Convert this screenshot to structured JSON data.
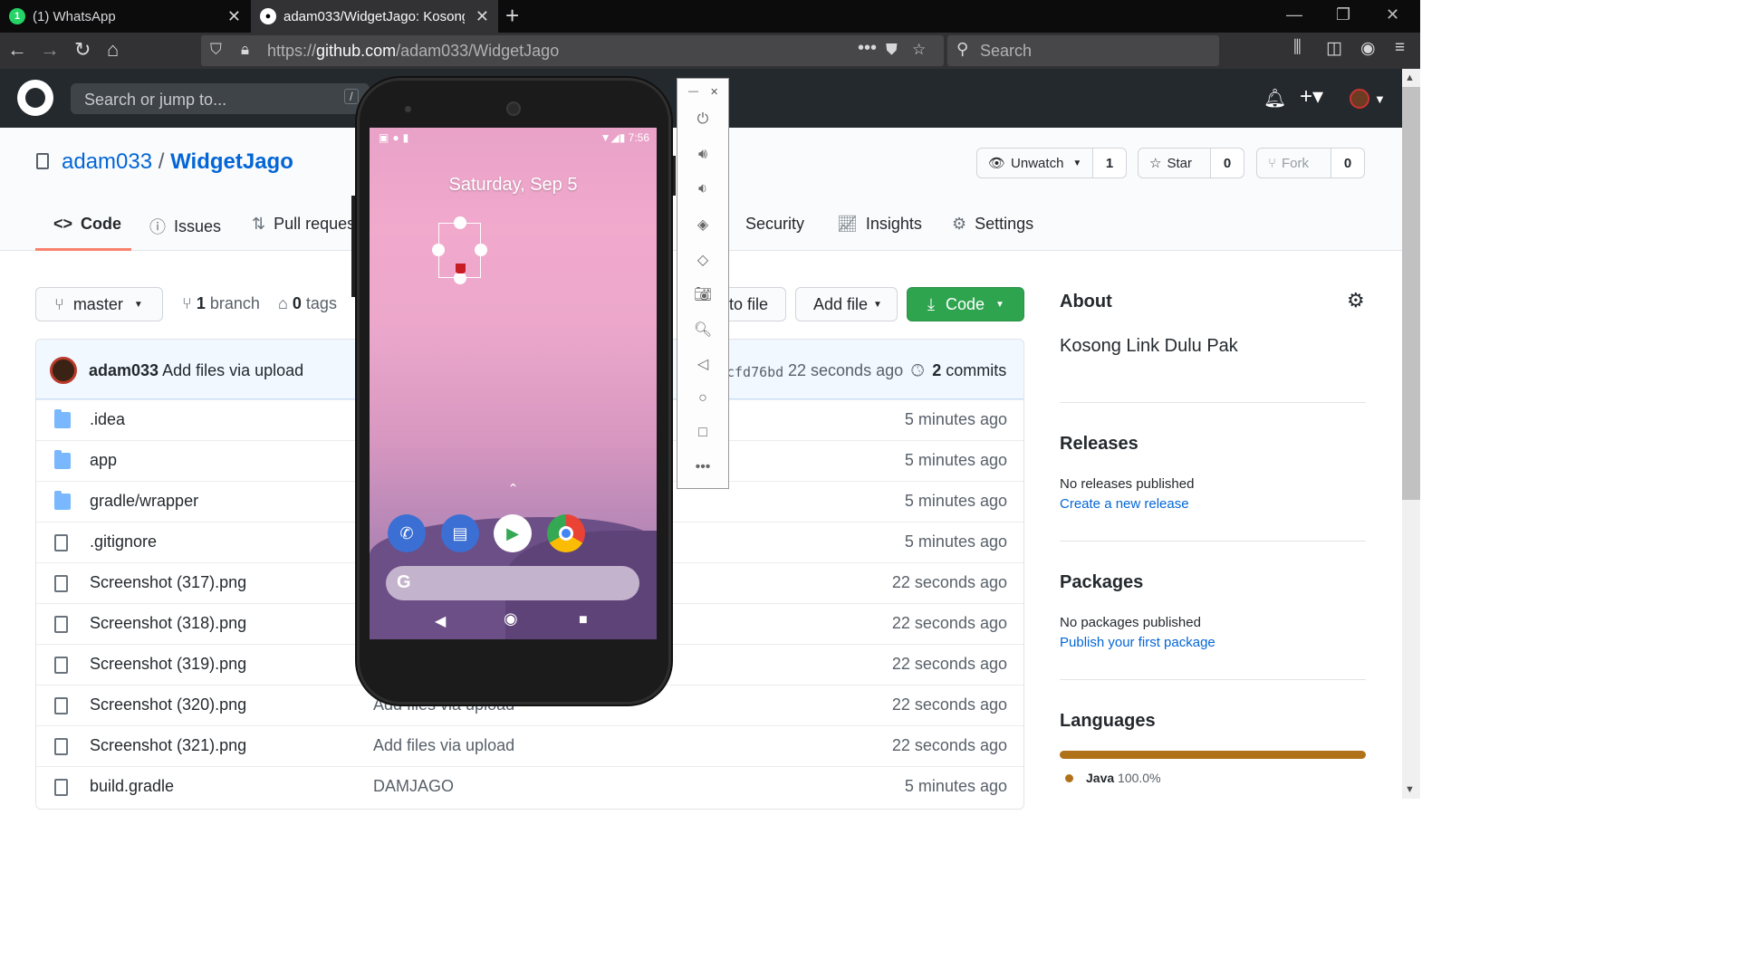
{
  "browser": {
    "tabs": [
      {
        "label": "(1) WhatsApp",
        "icon": "whatsapp-icon"
      },
      {
        "label": "adam033/WidgetJago: Kosong",
        "icon": "github-icon"
      }
    ],
    "url_prefix": "https://",
    "url_domain": "github.com",
    "url_path": "/adam033/WidgetJago",
    "search_placeholder": "Search"
  },
  "github": {
    "search_placeholder": "Search or jump to...",
    "search_key": "/",
    "owner": "adam033",
    "separator": "/",
    "repo": "WidgetJago",
    "watch_label": "Unwatch",
    "watch_count": "1",
    "star_label": "Star",
    "star_count": "0",
    "fork_label": "Fork",
    "fork_count": "0",
    "tabs": [
      {
        "label": "Code",
        "icon": "code-icon"
      },
      {
        "label": "Issues",
        "icon": "issue-icon"
      },
      {
        "label": "Pull reques",
        "icon": "pull-request-icon"
      },
      {
        "label": "Security",
        "icon": "shield-icon"
      },
      {
        "label": "Insights",
        "icon": "graph-icon"
      },
      {
        "label": "Settings",
        "icon": "gear-icon"
      }
    ],
    "branch_button": "master",
    "branch_count": "1",
    "branch_label": "branch",
    "tag_count": "0",
    "tag_label": "tags",
    "goto_file_label": "to file",
    "add_file_label": "Add file",
    "code_button_label": "Code",
    "commit": {
      "author": "adam033",
      "message": "Add files via upload",
      "sha": "cfd76bd",
      "time": "22 seconds ago",
      "commit_count": "2",
      "commit_label": "commits"
    },
    "files": [
      {
        "name": ".idea",
        "type": "folder",
        "message": "",
        "time": "5 minutes ago"
      },
      {
        "name": "app",
        "type": "folder",
        "message": "",
        "time": "5 minutes ago"
      },
      {
        "name": "gradle/wrapper",
        "type": "folder",
        "message": "",
        "time": "5 minutes ago"
      },
      {
        "name": ".gitignore",
        "type": "file",
        "message": "",
        "time": "5 minutes ago"
      },
      {
        "name": "Screenshot (317).png",
        "type": "file",
        "message": "",
        "time": "22 seconds ago"
      },
      {
        "name": "Screenshot (318).png",
        "type": "file",
        "message": "",
        "time": "22 seconds ago"
      },
      {
        "name": "Screenshot (319).png",
        "type": "file",
        "message": "",
        "time": "22 seconds ago"
      },
      {
        "name": "Screenshot (320).png",
        "type": "file",
        "message": "Add files via upload",
        "time": "22 seconds ago"
      },
      {
        "name": "Screenshot (321).png",
        "type": "file",
        "message": "Add files via upload",
        "time": "22 seconds ago"
      },
      {
        "name": "build.gradle",
        "type": "file",
        "message": "DAMJAGO",
        "time": "5 minutes ago"
      }
    ],
    "about": {
      "heading": "About",
      "description": "Kosong Link Dulu Pak"
    },
    "releases": {
      "heading": "Releases",
      "text": "No releases published",
      "link": "Create a new release"
    },
    "packages": {
      "heading": "Packages",
      "text": "No packages published",
      "link": "Publish your first package"
    },
    "languages": {
      "heading": "Languages",
      "name": "Java",
      "percent": "100.0%",
      "color": "#b07219"
    }
  },
  "emulator": {
    "clock": "7:56",
    "date": "Saturday, Sep 5",
    "search_glyph": "G",
    "dock_apps": [
      "phone-app-icon",
      "messages-app-icon",
      "play-store-icon",
      "chrome-icon"
    ],
    "toolbar": [
      "power-icon",
      "volume-up-icon",
      "volume-down-icon",
      "rotate-left-icon",
      "rotate-right-icon",
      "camera-icon",
      "zoom-icon",
      "back-icon",
      "home-icon",
      "overview-icon",
      "more-icon"
    ]
  },
  "colors": {
    "accent_green": "#2ea44f",
    "link_blue": "#0366d6",
    "tab_underline": "#f9826c"
  }
}
